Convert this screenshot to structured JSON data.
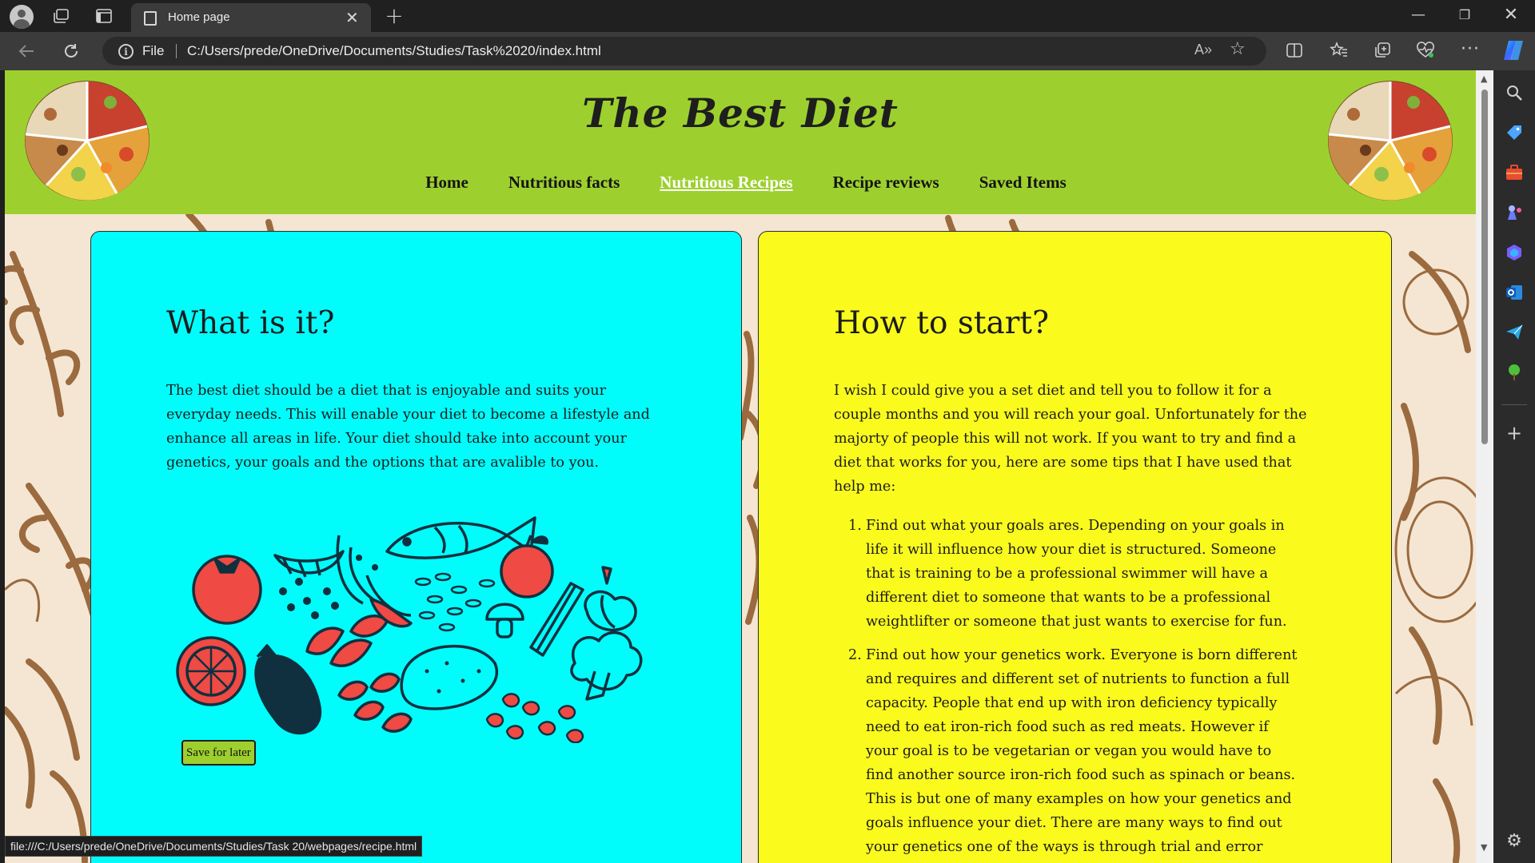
{
  "browser": {
    "tab_title": "Home page",
    "tab_close": "✕",
    "new_tab": "+",
    "address_scheme_label": "File",
    "address_url": "C:/Users/prede/OneDrive/Documents/Studies/Task%2020/index.html",
    "read_aloud": "A»",
    "window_min": "—",
    "window_max": "❐",
    "window_close": "✕",
    "status_url": "file:///C:/Users/prede/OneDrive/Documents/Studies/Task 20/webpages/recipe.html"
  },
  "site": {
    "title": "The Best Diet",
    "nav": [
      {
        "label": "Home",
        "active": false
      },
      {
        "label": "Nutritious facts",
        "active": false
      },
      {
        "label": "Nutritious Recipes",
        "active": true
      },
      {
        "label": "Recipe reviews",
        "active": false
      },
      {
        "label": "Saved Items",
        "active": false
      }
    ]
  },
  "what_card": {
    "heading": "What is it?",
    "body": "The best diet should be a diet that is enjoyable and suits your everyday needs. This will enable your diet to become a lifestyle and enhance all areas in life. Your diet should take into account your genetics, your goals and the options that are avalible to you.",
    "save_button": "Save for later"
  },
  "how_card": {
    "heading": "How to start?",
    "body": "I wish I could give you a set diet and tell you to follow it for a couple months and you will reach your goal. Unfortunately for the majorty of people this will not work. If you want to try and find a diet that works for you, here are some tips that I have used that help me:",
    "tips": [
      {
        "num": "1.",
        "text": "Find out what your goals ares. Depending on your goals in life it will influence how your diet is structured. Someone that is training to be a professional swimmer will have a different diet to someone that wants to be a professional weightlifter or someone that just wants to exercise for fun."
      },
      {
        "num": "2.",
        "text": "Find out how your genetics work. Everyone is born different and requires and different set of nutrients to function a full capacity. People that end up with iron deficiency typically need to eat iron-rich food such as red meats. However if your goal is to be vegetarian or vegan you would have to find another source iron-rich food such as spinach or beans. This is but one of many examples on how your genetics and goals influence your diet. There are many ways to find out your genetics one of the ways is through trial and error however this may take"
      }
    ]
  },
  "colors": {
    "header_green": "#9dd02e",
    "card_cyan": "#00fdfc",
    "card_yellow": "#fafa1d",
    "page_beige": "#f4e6d2",
    "veg_red": "#ef4a44",
    "veg_dark": "#10303f"
  },
  "icons": [
    "profile-icon",
    "workspaces-icon",
    "tab-actions-icon",
    "page-icon",
    "close-icon",
    "plus-icon",
    "back-icon",
    "reload-icon",
    "info-icon",
    "read-aloud-icon",
    "star-icon",
    "split-screen-icon",
    "favorites-icon",
    "collections-icon",
    "health-icon",
    "more-icon",
    "copilot-icon",
    "search-icon",
    "tag-icon",
    "briefcase-icon",
    "games-icon",
    "m365-icon",
    "outlook-icon",
    "send-icon",
    "tree-icon",
    "add-icon",
    "settings-icon"
  ]
}
